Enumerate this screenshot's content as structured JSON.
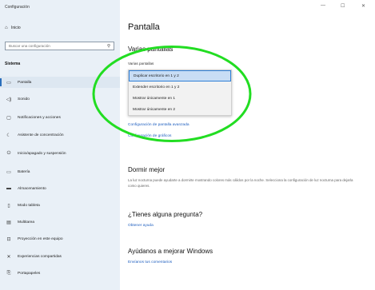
{
  "window": {
    "title": "Configuración",
    "controls": [
      "—",
      "☐",
      "✕"
    ]
  },
  "sidebar": {
    "home_label": "Inicio",
    "search_placeholder": "Buscar una configuración",
    "section_label": "Sistema",
    "items": [
      {
        "label": "Pantalla",
        "icon": "monitor-icon",
        "active": true
      },
      {
        "label": "Sonido",
        "icon": "speaker-icon"
      },
      {
        "label": "Notificaciones y acciones",
        "icon": "notification-icon"
      },
      {
        "label": "Asistente de concentración",
        "icon": "moon-icon"
      },
      {
        "label": "Inicio/apagado y suspensión",
        "icon": "power-icon"
      },
      {
        "label": "Batería",
        "icon": "battery-icon"
      },
      {
        "label": "Almacenamiento",
        "icon": "storage-icon"
      },
      {
        "label": "Modo tableta",
        "icon": "tablet-icon"
      },
      {
        "label": "Multitarea",
        "icon": "multitask-icon"
      },
      {
        "label": "Proyección en este equipo",
        "icon": "projection-icon"
      },
      {
        "label": "Experiencias compartidas",
        "icon": "shared-icon"
      },
      {
        "label": "Portapapeles",
        "icon": "clipboard-icon"
      }
    ]
  },
  "main": {
    "title": "Pantalla",
    "multi_heading": "Varias pantallas",
    "multi_label": "Varias pantallas",
    "dropdown_options": [
      "Duplicar escritorio en 1 y 2",
      "Extender escritorio en 1 y 2",
      "Mostrar únicamente en 1",
      "Mostrar únicamente en 2"
    ],
    "selected_index": 0,
    "advanced_link": "Configuración de pantalla avanzada",
    "graphics_link": "Configuración de gráficos",
    "sleep_heading": "Dormir mejor",
    "sleep_desc": "La luz nocturna puede ayudarte a dormirte mostrando colores más cálidos por la noche. Selecciona la configuración de luz nocturna para dejarla como quieres.",
    "question_heading": "¿Tienes alguna pregunta?",
    "help_link": "Obtener ayuda",
    "improve_heading": "Ayúdanos a mejorar Windows",
    "feedback_link": "Envíanos tus comentarios"
  },
  "colors": {
    "accent": "#2a6ebb",
    "annotation": "#22dd22"
  }
}
